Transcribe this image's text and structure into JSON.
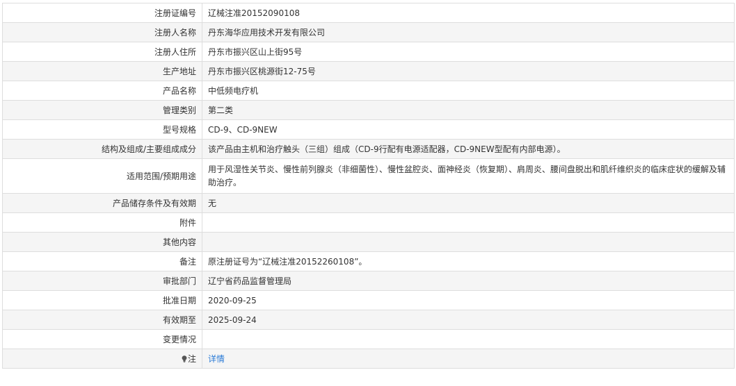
{
  "rows": [
    {
      "label": "注册证编号",
      "value": "辽械注准20152090108"
    },
    {
      "label": "注册人名称",
      "value": "丹东海华应用技术开发有限公司"
    },
    {
      "label": "注册人住所",
      "value": "丹东市振兴区山上街95号"
    },
    {
      "label": "生产地址",
      "value": "丹东市振兴区桃源街12-75号"
    },
    {
      "label": "产品名称",
      "value": "中低频电疗机"
    },
    {
      "label": "管理类别",
      "value": "第二类"
    },
    {
      "label": "型号规格",
      "value": "CD-9、CD-9NEW"
    },
    {
      "label": "结构及组成/主要组成成分",
      "value": "该产品由主机和治疗触头（三组）组成（CD-9行配有电源适配器，CD-9NEW型配有内部电源）。"
    },
    {
      "label": "适用范围/预期用途",
      "value": "用于风湿性关节炎、慢性前列腺炎（非细菌性）、慢性盆腔炎、面神经炎（恢复期）、肩周炎、腰间盘脱出和肌纤维织炎的临床症状的缓解及辅助治疗。"
    },
    {
      "label": "产品储存条件及有效期",
      "value": "无"
    },
    {
      "label": "附件",
      "value": ""
    },
    {
      "label": "其他内容",
      "value": ""
    },
    {
      "label": "备注",
      "value": "原注册证号为“辽械注准20152260108”。"
    },
    {
      "label": "审批部门",
      "value": "辽宁省药品监督管理局"
    },
    {
      "label": "批准日期",
      "value": "2020-09-25"
    },
    {
      "label": "有效期至",
      "value": "2025-09-24"
    },
    {
      "label": "变更情况",
      "value": ""
    },
    {
      "label": "注",
      "value": "详情",
      "icon": "lightbulb-icon"
    }
  ]
}
